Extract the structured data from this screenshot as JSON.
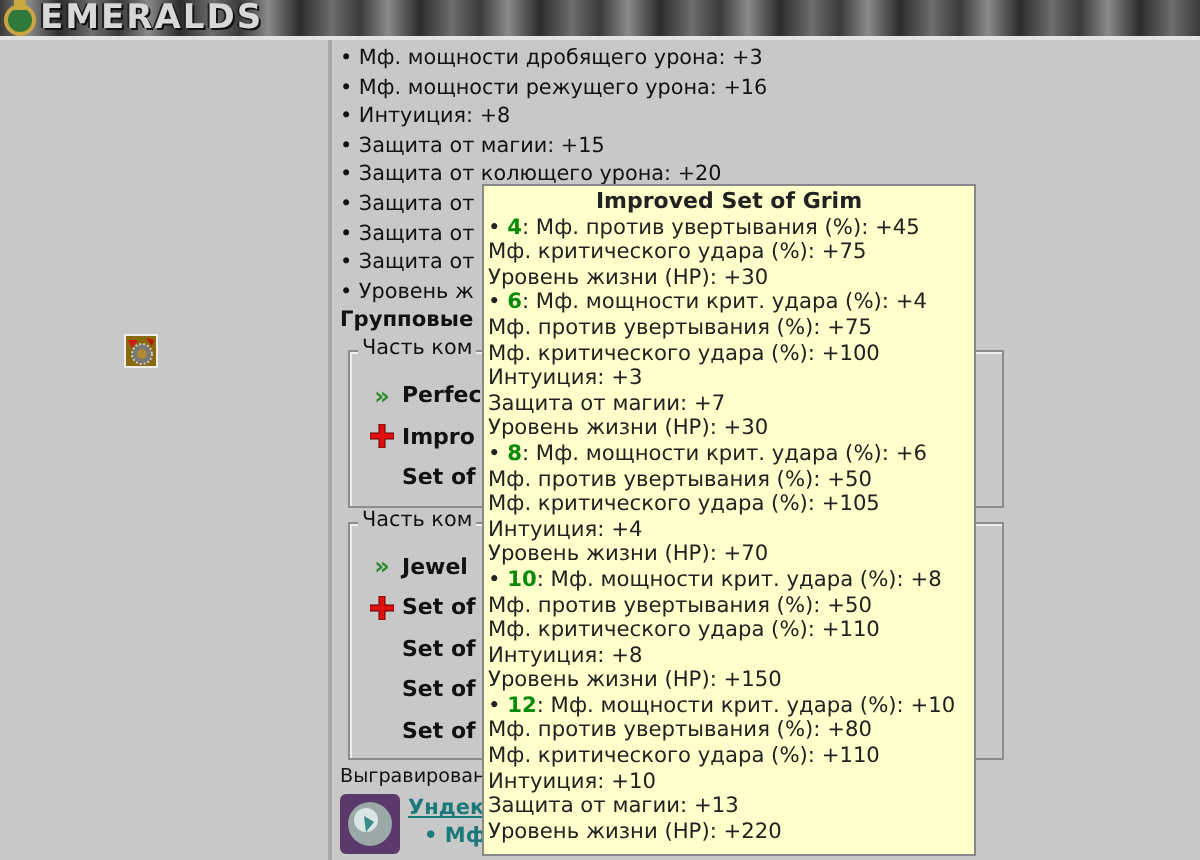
{
  "header": {
    "logo": "EMERALDS"
  },
  "stats": [
    "• Мф. мощности дробящего урона: +3",
    "• Мф. мощности режущего урона: +16",
    "• Интуиция: +8",
    "• Защита от магии: +15",
    "• Защита от колющего урона: +20",
    "• Защита от",
    "• Защита от",
    "• Защита от",
    "• Уровень ж"
  ],
  "group_heading": "Групповые",
  "fieldsets": [
    {
      "legend": "Часть ком",
      "items": [
        {
          "kind": "arrow",
          "marker": "»",
          "name": "Perfec"
        },
        {
          "kind": "plus",
          "name": "Impro"
        },
        {
          "kind": "plain",
          "name": "Set of"
        }
      ]
    },
    {
      "legend": "Часть ком",
      "items": [
        {
          "kind": "arrow",
          "marker": "»",
          "name": "Jewel"
        },
        {
          "kind": "plus",
          "name": "Set of"
        },
        {
          "kind": "plain",
          "name": "Set of"
        },
        {
          "kind": "plain",
          "name": "Set of"
        },
        {
          "kind": "plain",
          "name": "Set of"
        }
      ]
    }
  ],
  "engraving": {
    "label": "Выгравирован",
    "link": "Ундек",
    "bonus": "• Мф"
  },
  "tooltip": {
    "title": "Improved Set of Grim",
    "tiers": [
      {
        "bullet": "•",
        "count": "4",
        "first": ": Мф. против увертывания (%): +45",
        "lines": [
          "Мф. критического удара (%): +75",
          "Уровень жизни (HP): +30"
        ]
      },
      {
        "bullet": "•",
        "count": "6",
        "first": ": Мф. мощности крит. удара (%): +4",
        "lines": [
          "Мф. против увертывания (%): +75",
          "Мф. критического удара (%): +100",
          "Интуиция: +3",
          "Защита от магии: +7",
          "Уровень жизни (HP): +30"
        ]
      },
      {
        "bullet": "•",
        "count": "8",
        "first": ": Мф. мощности крит. удара (%): +6",
        "lines": [
          "Мф. против увертывания (%): +50",
          "Мф. критического удара (%): +105",
          "Интуиция: +4",
          "Уровень жизни (HP): +70"
        ]
      },
      {
        "bullet": "•",
        "count": "10",
        "first": ": Мф. мощности крит. удара (%): +8",
        "lines": [
          "Мф. против увертывания (%): +50",
          "Мф. критического удара (%): +110",
          "Интуиция: +8",
          "Уровень жизни (HP): +150"
        ]
      },
      {
        "bullet": "•",
        "count": "12",
        "first": ": Мф. мощности крит. удара (%): +10",
        "lines": [
          "Мф. против увертывания (%): +80",
          "Мф. критического удара (%): +110",
          "Интуиция: +10",
          "Защита от магии: +13",
          "Уровень жизни (HP): +220"
        ]
      }
    ]
  }
}
